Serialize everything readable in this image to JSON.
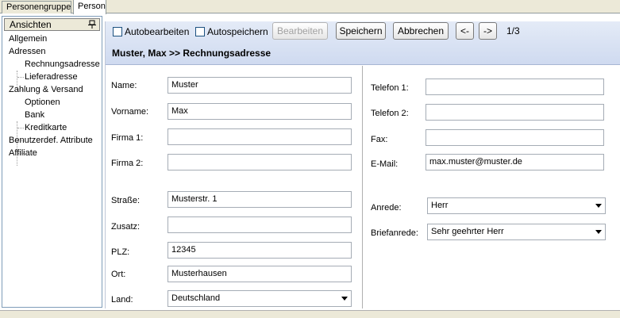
{
  "tabs": [
    "Personengruppe",
    "Person"
  ],
  "sidebar": {
    "header": "Ansichten",
    "items": [
      {
        "label": "Allgemein",
        "level": 0
      },
      {
        "label": "Adressen",
        "level": 0
      },
      {
        "label": "Rechnungsadresse",
        "level": 1
      },
      {
        "label": "Lieferadresse",
        "level": 1
      },
      {
        "label": "Zahlung & Versand",
        "level": 0
      },
      {
        "label": "Optionen",
        "level": 1
      },
      {
        "label": "Bank",
        "level": 1
      },
      {
        "label": "Kreditkarte",
        "level": 1
      },
      {
        "label": "Benutzerdef. Attribute",
        "level": 0
      },
      {
        "label": "Affiliate",
        "level": 0
      }
    ]
  },
  "toolbar": {
    "autobearbeiten": "Autobearbeiten",
    "autospeichern": "Autospeichern",
    "bearbeiten": "Bearbeiten",
    "speichern": "Speichern",
    "abbrechen": "Abbrechen",
    "prev": "<-",
    "next": "->",
    "counter": "1/3"
  },
  "breadcrumb": "Muster, Max >> Rechnungsadresse",
  "form_left": {
    "name_label": "Name:",
    "name": "Muster",
    "vorname_label": "Vorname:",
    "vorname": "Max",
    "firma1_label": "Firma 1:",
    "firma1": "",
    "firma2_label": "Firma 2:",
    "firma2": "",
    "strasse_label": "Straße:",
    "strasse": "Musterstr. 1",
    "zusatz_label": "Zusatz:",
    "zusatz": "",
    "plz_label": "PLZ:",
    "plz": "12345",
    "ort_label": "Ort:",
    "ort": "Musterhausen",
    "land_label": "Land:",
    "land": "Deutschland"
  },
  "form_right": {
    "telefon1_label": "Telefon 1:",
    "telefon1": "",
    "telefon2_label": "Telefon 2:",
    "telefon2": "",
    "fax_label": "Fax:",
    "fax": "",
    "email_label": "E-Mail:",
    "email": "max.muster@muster.de",
    "anrede_label": "Anrede:",
    "anrede": "Herr",
    "briefanrede_label": "Briefanrede:",
    "briefanrede": "Sehr geehrter Herr"
  }
}
